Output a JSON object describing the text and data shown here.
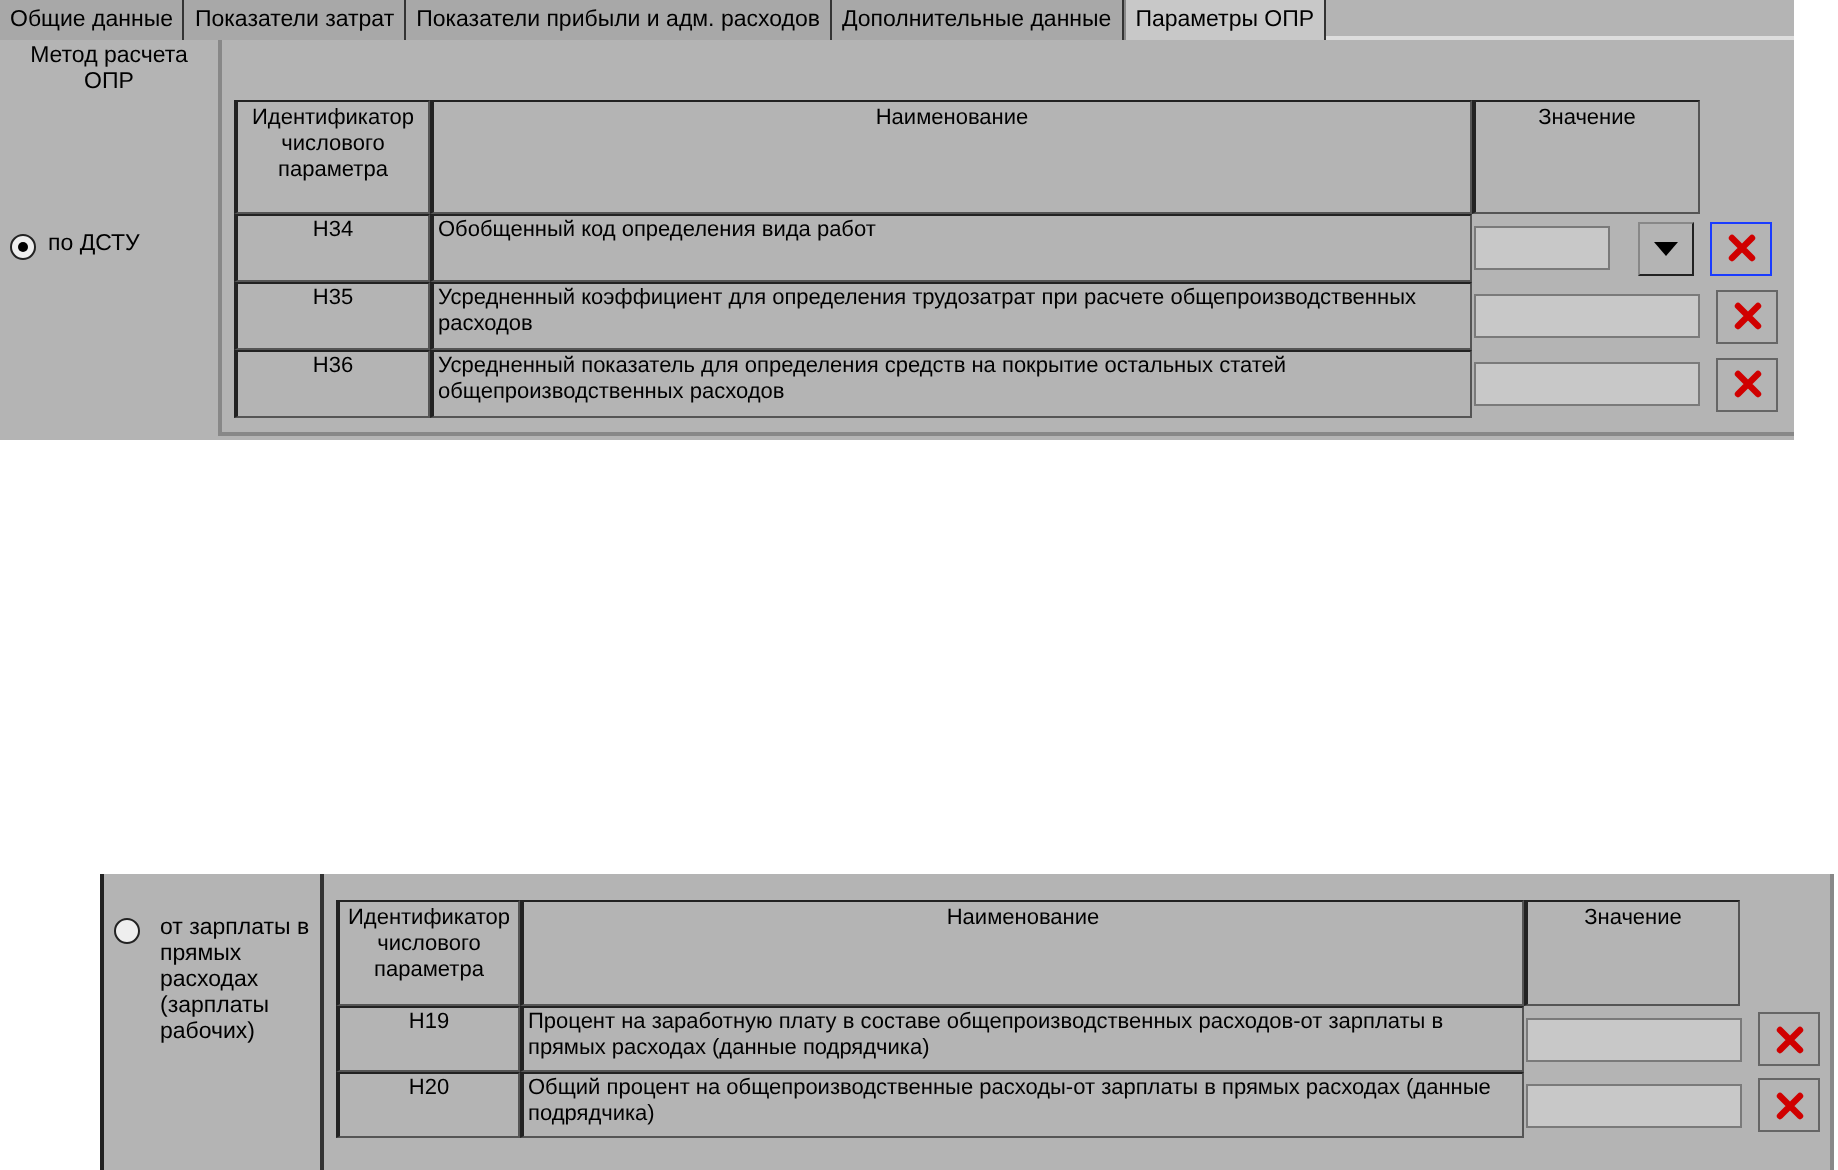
{
  "tabs": [
    {
      "label": "Общие данные",
      "selected": false
    },
    {
      "label": "Показатели затрат",
      "selected": false
    },
    {
      "label": "Показатели прибыли и адм. расходов",
      "selected": false
    },
    {
      "label": "Дополнительные данные",
      "selected": false
    },
    {
      "label": "Параметры ОПР",
      "selected": true
    }
  ],
  "method_heading": "Метод расчета ОПР",
  "sections": [
    {
      "method": {
        "label": "по ДСТУ",
        "selected": true
      },
      "columns": [
        "Идентификатор числового параметра",
        "Наименование",
        "Значение"
      ],
      "rows": [
        {
          "kind": "dropdown",
          "id": "Н34",
          "name": "Обобщенный код определения вида работ",
          "focused": true
        },
        {
          "kind": "text",
          "id": "Н35",
          "name": "Усредненный коэффициент для определения трудозатрат при расчете общепроизводственных расходов",
          "focused": false
        },
        {
          "kind": "text",
          "id": "Н36",
          "name": "Усредненный показатель для определения средств на покрытие остальных статей общепроизводственных расходов",
          "focused": false
        }
      ]
    },
    {
      "method": {
        "label": "от зарплаты в прямых расходах (зарплаты рабочих)",
        "selected": false
      },
      "columns": [
        "Идентификатор числового параметра",
        "Наименование",
        "Значение"
      ],
      "rows": [
        {
          "kind": "text",
          "id": "Н19",
          "name": "Процент на заработную плату в составе общепроизводственных расходов-от зарплаты в прямых расходах (данные подрядчика)",
          "focused": false
        },
        {
          "kind": "text",
          "id": "Н20",
          "name": "Общий процент на общепроизводственные расходы-от зарплаты в прямых расходах (данные подрядчика)",
          "focused": false
        }
      ]
    }
  ]
}
